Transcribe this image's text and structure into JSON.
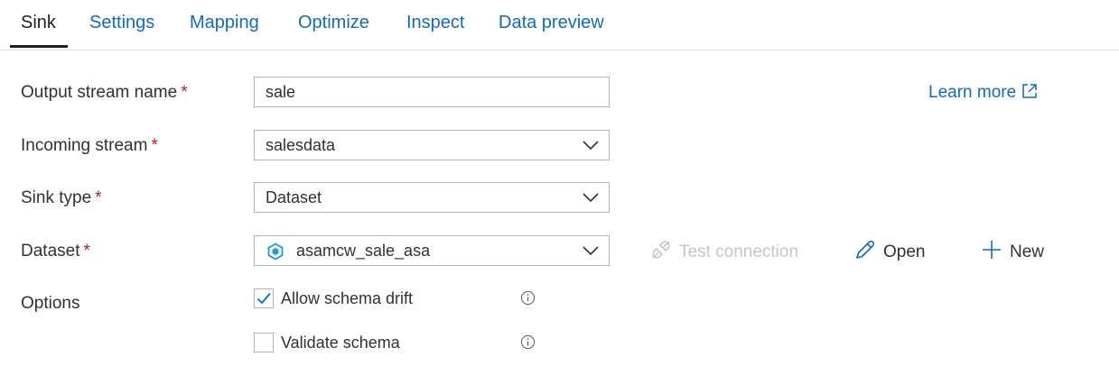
{
  "tabs": [
    {
      "label": "Sink"
    },
    {
      "label": "Settings"
    },
    {
      "label": "Mapping"
    },
    {
      "label": "Optimize"
    },
    {
      "label": "Inspect"
    },
    {
      "label": "Data preview"
    }
  ],
  "active_tab": "Sink",
  "form": {
    "output_stream_name": {
      "label": "Output stream name",
      "required": "*",
      "value": "sale"
    },
    "incoming_stream": {
      "label": "Incoming stream",
      "required": "*",
      "value": "salesdata"
    },
    "sink_type": {
      "label": "Sink type",
      "required": "*",
      "value": "Dataset"
    },
    "dataset": {
      "label": "Dataset",
      "required": "*",
      "value": "asamcw_sale_asa",
      "icon": "dataset-icon"
    },
    "options": {
      "label": "Options",
      "allow_schema_drift": {
        "label": "Allow schema drift",
        "checked": true
      },
      "validate_schema": {
        "label": "Validate schema",
        "checked": false
      }
    }
  },
  "learn_more": {
    "label": "Learn more",
    "icon": "external-link-icon"
  },
  "actions": {
    "test_connection": {
      "label": "Test connection",
      "disabled": true,
      "icon": "plug-icon"
    },
    "open": {
      "label": "Open",
      "icon": "pencil-icon"
    },
    "new": {
      "label": "New",
      "icon": "plus-icon"
    }
  },
  "colors": {
    "accent": "#0f6cbd",
    "required": "#a4262c",
    "disabled": "#c8c6c4",
    "text": "#323130"
  }
}
